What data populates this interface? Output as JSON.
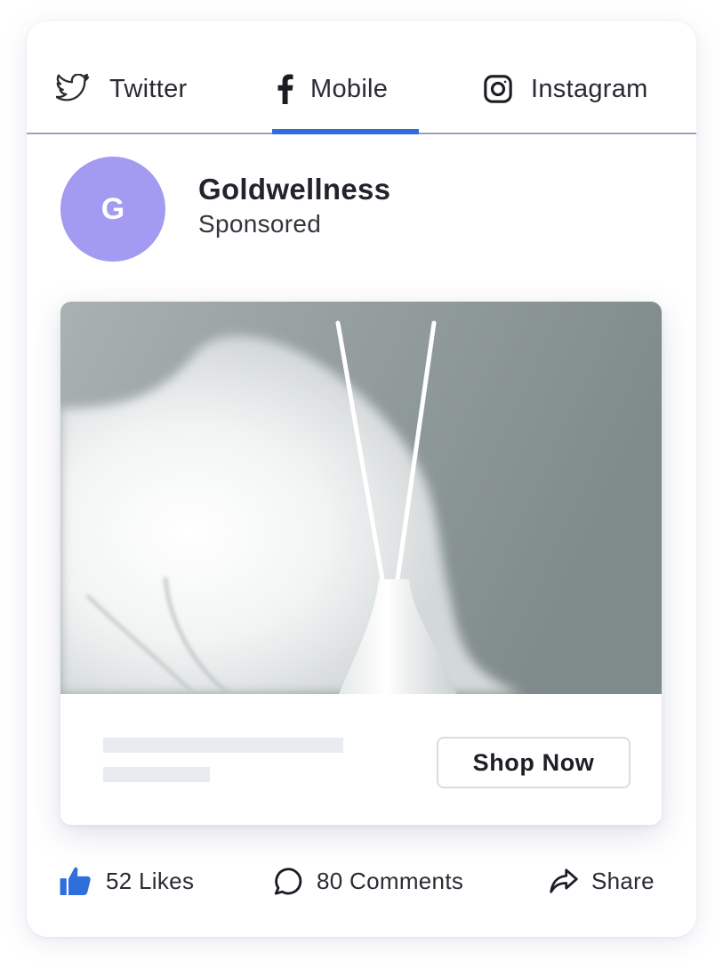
{
  "tabs": [
    {
      "label": "Twitter",
      "icon": "twitter-icon",
      "active": false
    },
    {
      "label": "Mobile",
      "icon": "facebook-icon",
      "active": true
    },
    {
      "label": "Instagram",
      "icon": "instagram-icon",
      "active": false
    }
  ],
  "post": {
    "avatar_initial": "G",
    "brand_name": "Goldwellness",
    "sponsored_label": "Sponsored",
    "image_icon": "reed-diffuser-photo",
    "cta_label": "Shop Now"
  },
  "actions": {
    "likes": "52 Likes",
    "comments": "80 Comments",
    "share": "Share"
  },
  "colors": {
    "accent": "#2f6fdc",
    "avatar": "#a39af1",
    "like_icon": "#2f6fdc",
    "divider": "#9aa1b8",
    "placeholder": "#e8ebf1"
  }
}
